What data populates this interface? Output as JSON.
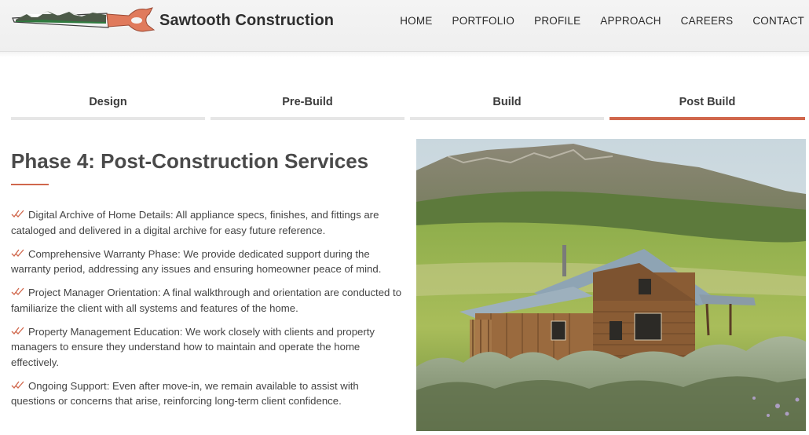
{
  "site": {
    "brand": "Sawtooth Construction"
  },
  "nav": [
    {
      "label": "HOME"
    },
    {
      "label": "PORTFOLIO"
    },
    {
      "label": "PROFILE"
    },
    {
      "label": "APPROACH"
    },
    {
      "label": "CAREERS"
    },
    {
      "label": "CONTACT"
    }
  ],
  "tabs": [
    {
      "label": "Design",
      "active": false
    },
    {
      "label": "Pre-Build",
      "active": false
    },
    {
      "label": "Build",
      "active": false
    },
    {
      "label": "Post Build",
      "active": true
    }
  ],
  "content": {
    "heading": "Phase 4: Post-Construction Services",
    "items": [
      {
        "text": "Digital Archive of Home Details: All appliance specs, finishes, and fittings are cataloged and delivered in a digital archive for easy future reference."
      },
      {
        "text": "Comprehensive Warranty Phase: We provide dedicated support during the warranty period, addressing any issues and ensuring homeowner peace of mind."
      },
      {
        "text": "Project Manager Orientation: A final walkthrough and orientation are conducted to familiarize the client with all systems and features of the home."
      },
      {
        "text": "Property Management Education: We work closely with clients and property managers to ensure they understand how to maintain and operate the home effectively."
      },
      {
        "text": "Ongoing Support: Even after move-in, we remain available to assist with questions or concerns that arise, reinforcing long-term client confidence."
      }
    ]
  },
  "icons": {
    "list_marker": "double-check-icon",
    "logo": "mountain-saw-logo"
  },
  "colors": {
    "accent": "#d0674c",
    "tab_inactive": "#e6e6e6",
    "text": "#444444"
  }
}
